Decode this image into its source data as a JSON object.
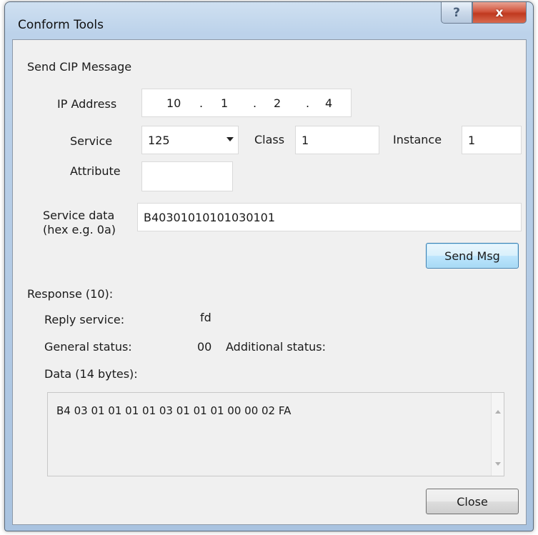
{
  "window": {
    "title": "Conform Tools",
    "help_glyph": "?",
    "close_glyph": "x"
  },
  "send": {
    "section_label": "Send CIP Message",
    "ip_label": "IP Address",
    "ip_octets": [
      "10",
      "1",
      "2",
      "4"
    ],
    "ip_separator": ".",
    "service_label": "Service",
    "service_value": "125",
    "class_label": "Class",
    "class_value": "1",
    "instance_label": "Instance",
    "instance_value": "1",
    "attribute_label": "Attribute",
    "attribute_value": "",
    "service_data_label_line1": "Service data",
    "service_data_label_line2": "(hex e.g. 0a)",
    "service_data_value": "B40301010101030101",
    "send_button": "Send Msg"
  },
  "response": {
    "label": "Response (10):",
    "reply_service_label": "Reply service:",
    "reply_service_value": "fd",
    "general_status_label": "General status:",
    "general_status_value": "00",
    "additional_status_label": "Additional status:",
    "data_label": "Data (14 bytes):",
    "data_value": "B4 03 01 01 01 01 03 01 01 01 00 00 02 FA"
  },
  "close_button": "Close",
  "colors": {
    "frame": "#a9c3e0",
    "client_bg": "#f0f0f0",
    "close_red": "#c0391f",
    "default_button_border": "#3c7fb1"
  }
}
